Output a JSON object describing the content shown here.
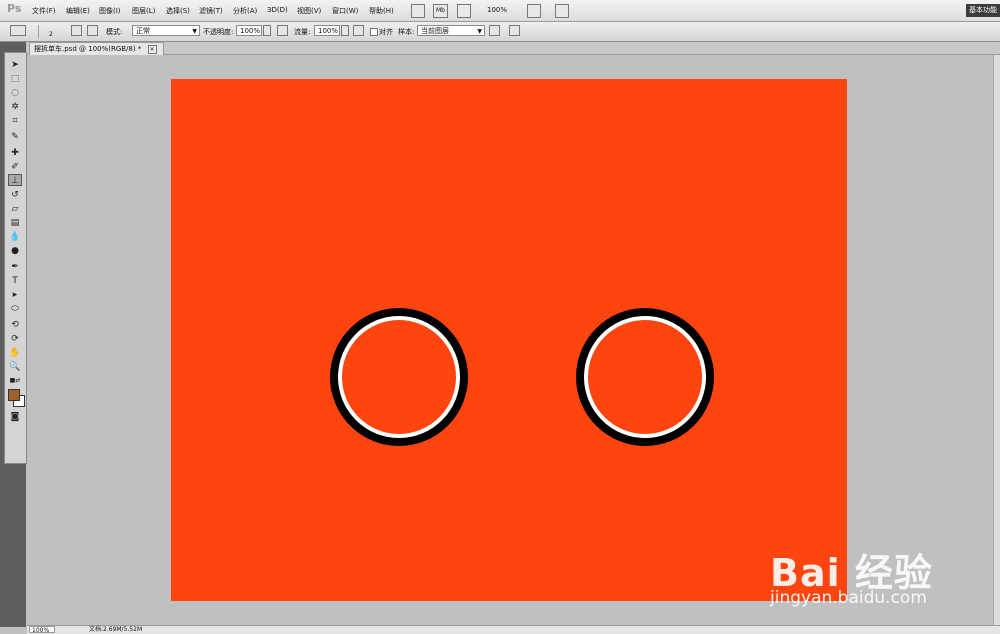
{
  "app": {
    "logo": "Ps",
    "workspace": "基本功能"
  },
  "menu": {
    "items": [
      "文件(F)",
      "编辑(E)",
      "图像(I)",
      "图层(L)",
      "选择(S)",
      "滤镜(T)",
      "分析(A)",
      "3D(D)",
      "视图(V)",
      "窗口(W)",
      "帮助(H)"
    ],
    "zoom": "100%",
    "icons": [
      "br-icon",
      "mb-icon"
    ]
  },
  "options": {
    "brush_size": "2",
    "mode_label": "模式:",
    "mode_value": "正常",
    "opacity_label": "不透明度:",
    "opacity_value": "100%",
    "flow_label": "流量:",
    "flow_value": "100%",
    "align_label": "对齐",
    "sample_label": "样本:",
    "sample_value": "当前图层"
  },
  "document": {
    "tab_title": "摆拆单车.psd @ 100%(RGB/8) *",
    "close": "×"
  },
  "status": {
    "zoom": "100%",
    "doc_info": "文档:2.69M/5.52M"
  },
  "watermark": {
    "logo": "Bai 经验",
    "url": "jingyan.baidu.com"
  },
  "colors": {
    "canvas": "#fe450f",
    "ring_outer": "#000000",
    "ring_inner": "#ffffff",
    "foreground": "#a0622d",
    "background": "#ffffff"
  }
}
